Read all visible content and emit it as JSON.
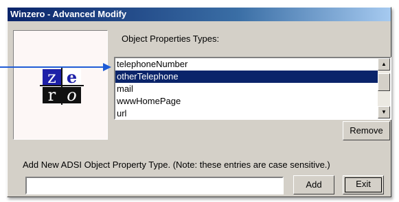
{
  "window": {
    "title": "Winzero - Advanced Modify"
  },
  "logo": {
    "letters": [
      "z",
      "e",
      "r",
      "o"
    ],
    "colors": {
      "blue": "#1e20a8",
      "black": "#111111"
    }
  },
  "properties": {
    "label": "Object Properties Types:",
    "items": [
      "telephoneNumber",
      "otherTelephone",
      "mail",
      "wwwHomePage",
      "url"
    ],
    "selected": "otherTelephone"
  },
  "buttons": {
    "remove": "Remove",
    "add": "Add",
    "exit": "Exit"
  },
  "new_property": {
    "instruction": "Add New ADSI Object Property Type. (Note: these entries are case sensitive.)",
    "value": "",
    "placeholder": ""
  },
  "icons": {
    "scroll_up": "scroll-up-arrow-icon",
    "scroll_down": "scroll-down-arrow-icon",
    "pointer_arrow": "pointer-arrow-icon"
  },
  "colors": {
    "titlebar": "#0a246a",
    "selection": "#0a246a",
    "pointer_arrow": "#1e5bd6",
    "dialog_face": "#d4d0c8"
  }
}
